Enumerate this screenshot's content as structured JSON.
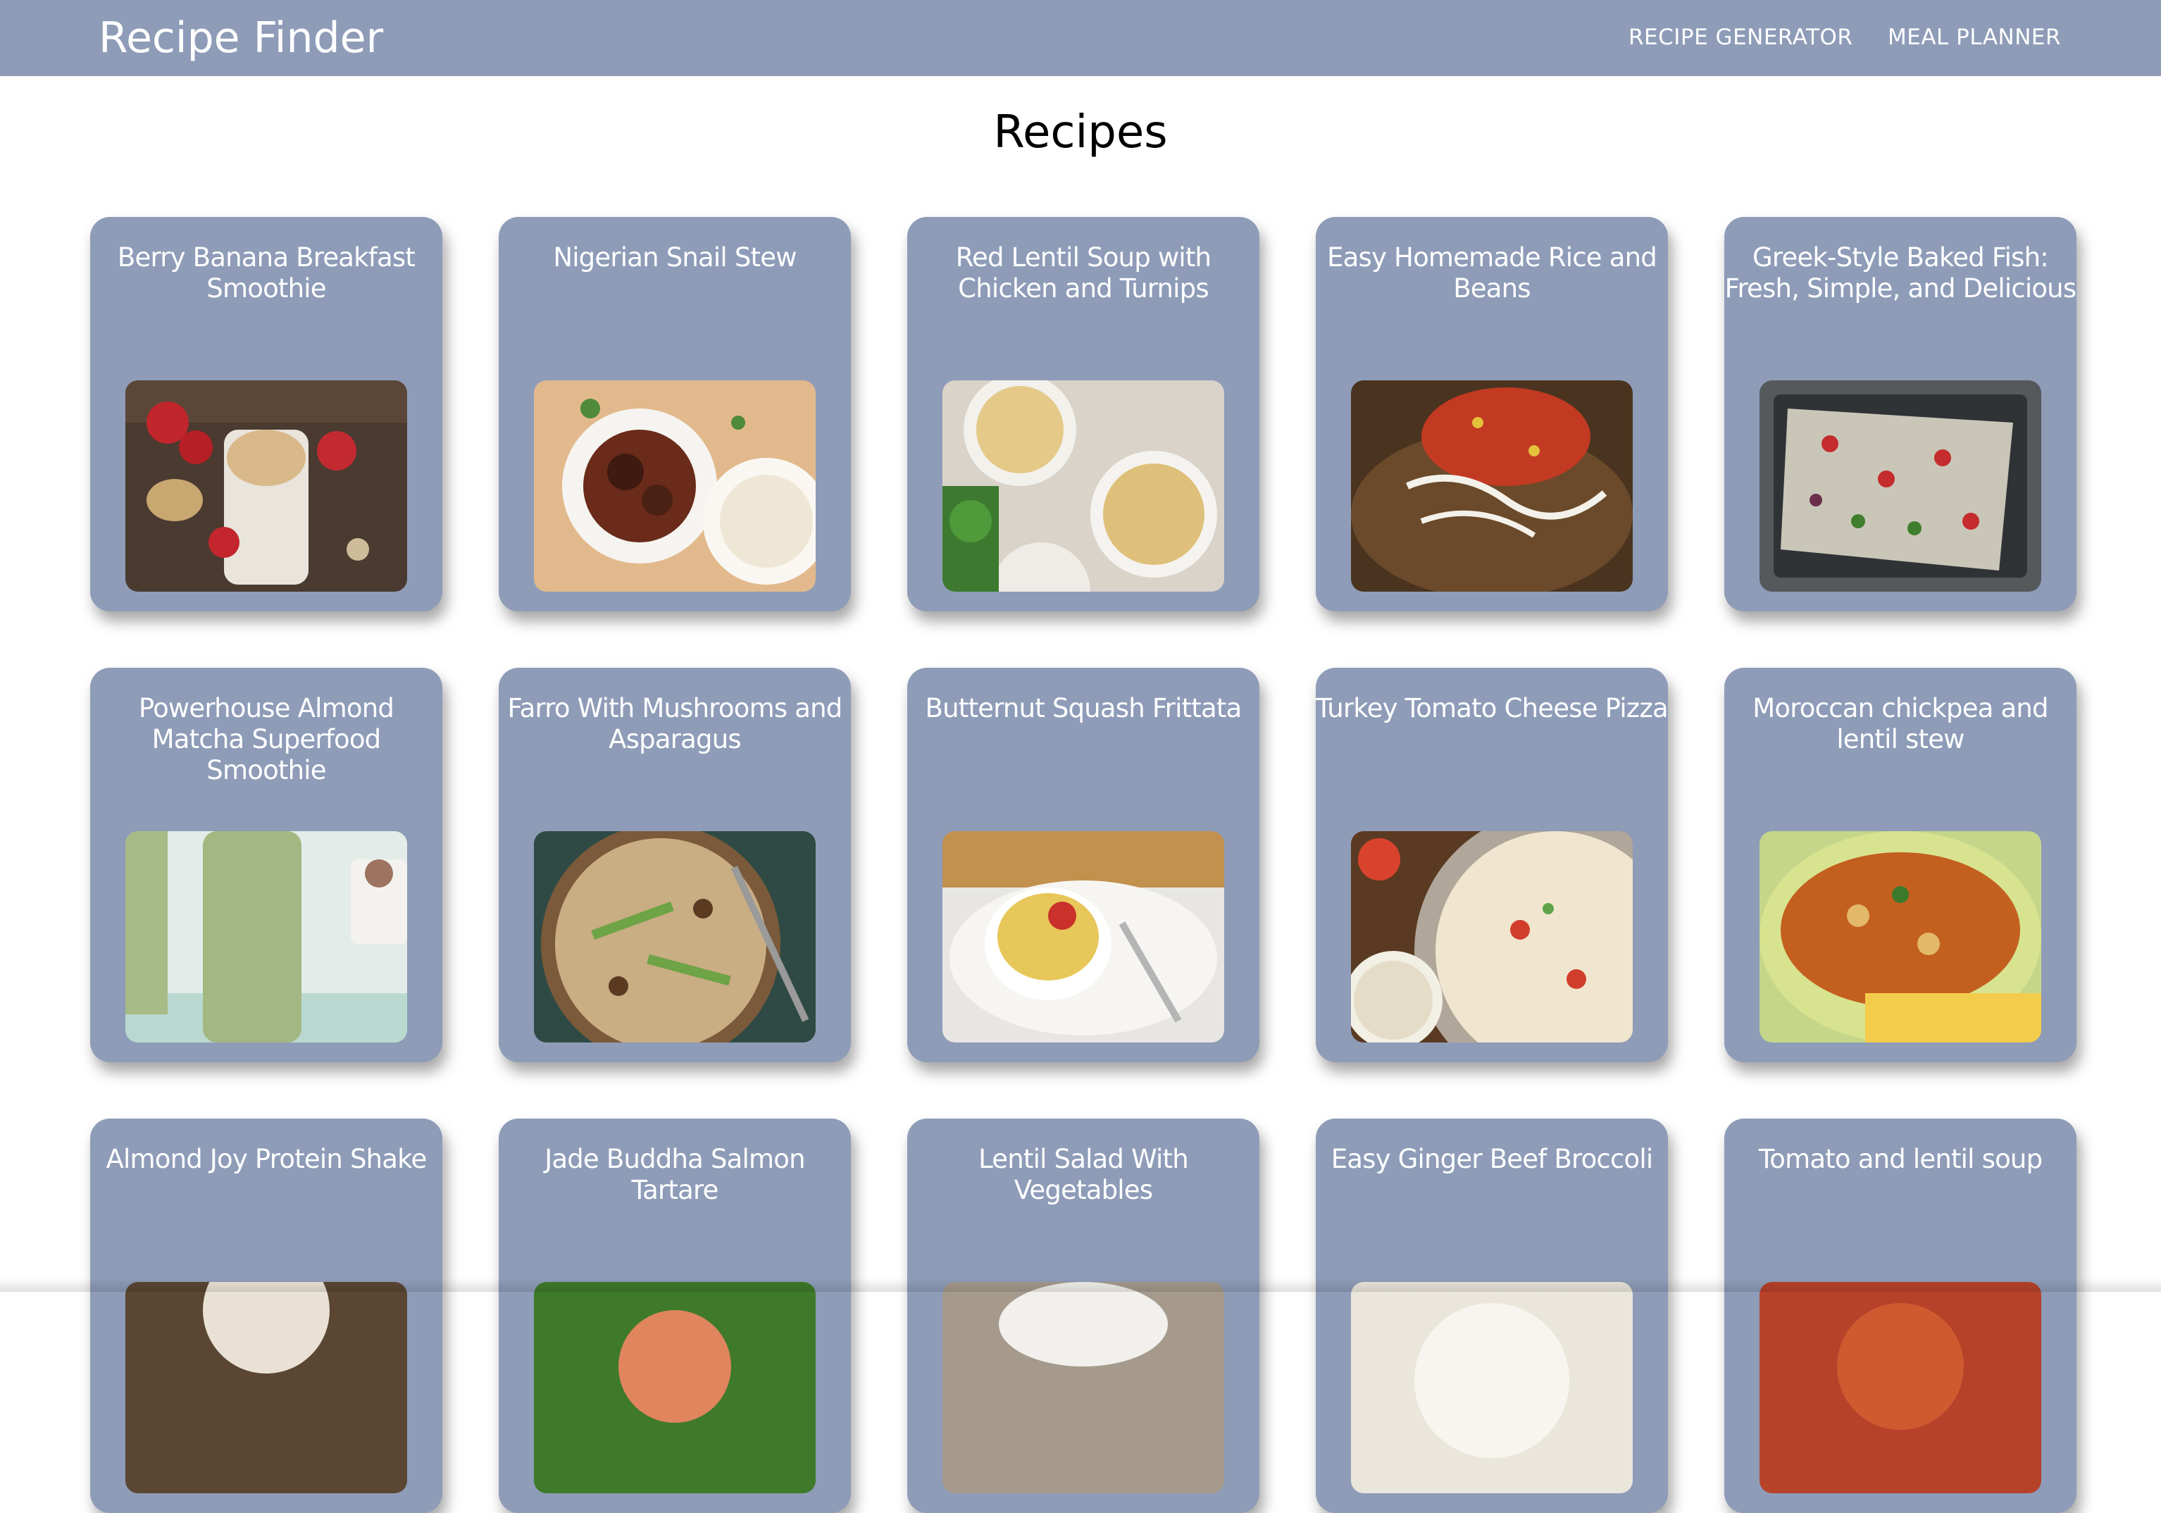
{
  "header": {
    "brand": "Recipe Finder",
    "nav": [
      "RECIPE GENERATOR",
      "MEAL PLANNER"
    ]
  },
  "main": {
    "title": "Recipes",
    "recipes": [
      {
        "title": "Berry Banana Breakfast Smoothie"
      },
      {
        "title": "Nigerian Snail Stew"
      },
      {
        "title": "Red Lentil Soup with Chicken and Turnips"
      },
      {
        "title": "Easy Homemade Rice and Beans"
      },
      {
        "title": "Greek-Style Baked Fish: Fresh, Simple, and Delicious"
      },
      {
        "title": "Powerhouse Almond Matcha Superfood Smoothie"
      },
      {
        "title": "Farro With Mushrooms and Asparagus"
      },
      {
        "title": "Butternut Squash Frittata"
      },
      {
        "title": "Turkey Tomato Cheese Pizza"
      },
      {
        "title": "Moroccan chickpea and lentil stew"
      },
      {
        "title": "Almond Joy Protein Shake"
      },
      {
        "title": "Jade Buddha Salmon Tartare"
      },
      {
        "title": "Lentil Salad With Vegetables"
      },
      {
        "title": "Easy Ginger Beef Broccoli"
      },
      {
        "title": "Tomato and lentil soup"
      }
    ]
  },
  "colors": {
    "navbar": "#8e9cb8",
    "card": "#8e9cb8",
    "text_on_card": "#ffffff"
  }
}
